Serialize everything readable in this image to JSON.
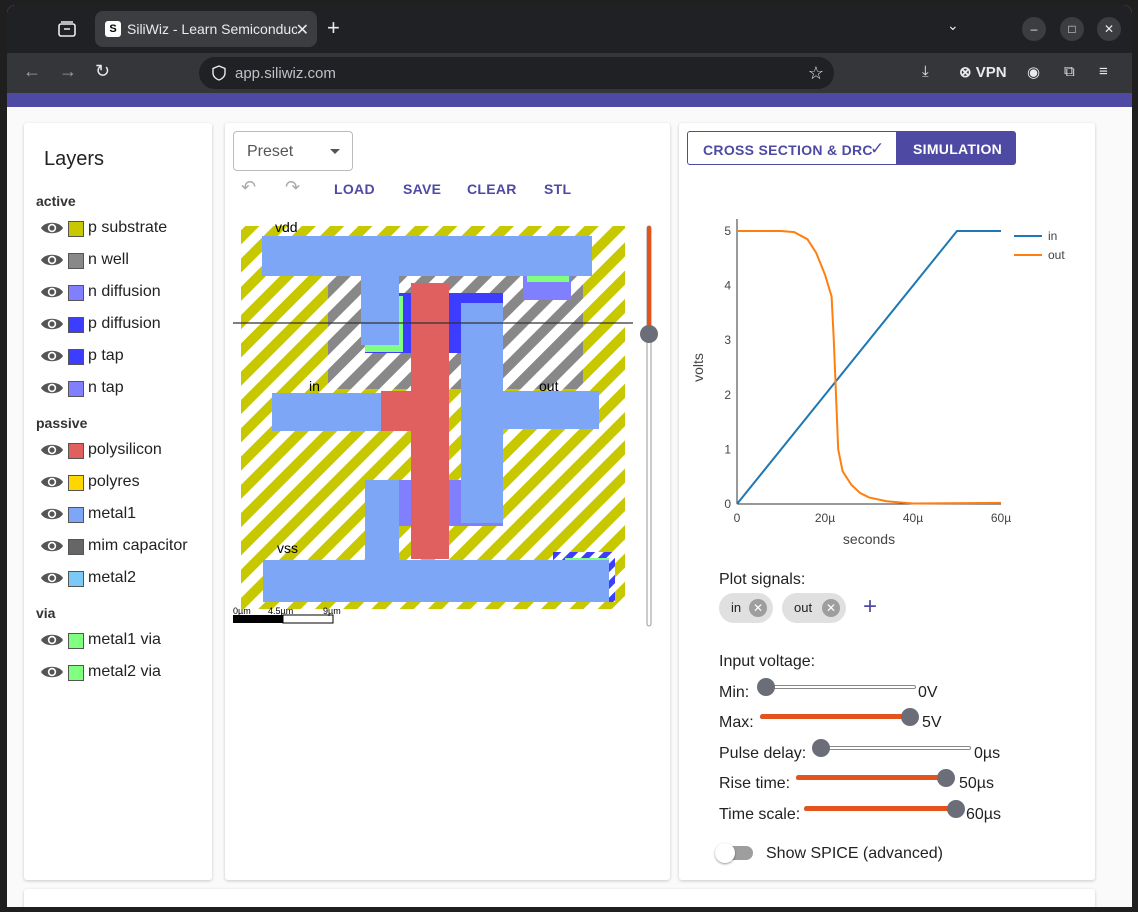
{
  "browser": {
    "tab_title": "SiliWiz - Learn Semiconductor",
    "tab_favicon": "S",
    "url": "app.siliwiz.com",
    "vpn_label": "VPN"
  },
  "layers": {
    "title": "Layers",
    "groups": [
      {
        "name": "active",
        "items": [
          {
            "label": "p substrate",
            "color": "#c8c800"
          },
          {
            "label": "n well",
            "color": "#888888"
          },
          {
            "label": "n diffusion",
            "color": "#8080ff"
          },
          {
            "label": "p diffusion",
            "color": "#3d3dff"
          },
          {
            "label": "p tap",
            "color": "#3d3dff"
          },
          {
            "label": "n tap",
            "color": "#8080ff"
          }
        ]
      },
      {
        "name": "passive",
        "items": [
          {
            "label": "polysilicon",
            "color": "#e06060"
          },
          {
            "label": "polyres",
            "color": "#ffd700"
          },
          {
            "label": "metal1",
            "color": "#7ea6f6"
          },
          {
            "label": "mim capacitor",
            "color": "#666666"
          },
          {
            "label": "metal2",
            "color": "#7cc8f6"
          }
        ]
      },
      {
        "name": "via",
        "items": [
          {
            "label": "metal1 via",
            "color": "#80ff80"
          },
          {
            "label": "metal2 via",
            "color": "#80ff80"
          }
        ]
      }
    ]
  },
  "editor": {
    "preset_label": "Preset",
    "load_label": "LOAD",
    "save_label": "SAVE",
    "clear_label": "CLEAR",
    "stl_label": "STL",
    "labels": {
      "vdd": "vdd",
      "in": "in",
      "out": "out",
      "vss": "vss"
    },
    "scale": [
      "0µm",
      "4.5µm",
      "9µm"
    ],
    "cut_level": 0.27
  },
  "tabs": {
    "cross_section_label": "CROSS SECTION & DRC",
    "simulation_label": "SIMULATION"
  },
  "chart_data": {
    "type": "line",
    "xlabel": "seconds",
    "ylabel": "volts",
    "xlim": [
      0,
      60
    ],
    "ylim": [
      0,
      5
    ],
    "xticks": [
      "0",
      "20µ",
      "40µ",
      "60µ"
    ],
    "yticks": [
      "0",
      "1",
      "2",
      "3",
      "4",
      "5"
    ],
    "legend_position": "top-right",
    "series": [
      {
        "name": "in",
        "color": "#1f77b4",
        "x": [
          0,
          50,
          60
        ],
        "y": [
          0,
          5,
          5
        ]
      },
      {
        "name": "out",
        "color": "#ff7f0e",
        "x": [
          0,
          10,
          13,
          16,
          18,
          20,
          21.5,
          22,
          22.5,
          23,
          24,
          26,
          28,
          30,
          34,
          40,
          60
        ],
        "y": [
          5,
          5,
          4.98,
          4.85,
          4.6,
          4.2,
          3.8,
          3.0,
          2.0,
          1.0,
          0.6,
          0.35,
          0.2,
          0.12,
          0.05,
          0.01,
          0.02
        ]
      }
    ]
  },
  "simulation": {
    "plot_signals_label": "Plot signals:",
    "signals": [
      "in",
      "out"
    ],
    "input_voltage_label": "Input voltage:",
    "controls": [
      {
        "label": "Min:",
        "value_text": "0V",
        "fraction": 0.0
      },
      {
        "label": "Max:",
        "value_text": "5V",
        "fraction": 1.0
      },
      {
        "label": "Pulse delay:",
        "value_text": "0µs",
        "fraction": 0.0
      },
      {
        "label": "Rise time:",
        "value_text": "50µs",
        "fraction": 1.0
      },
      {
        "label": "Time scale:",
        "value_text": "60µs",
        "fraction": 0.95
      }
    ],
    "spice_label": "Show SPICE (advanced)"
  }
}
